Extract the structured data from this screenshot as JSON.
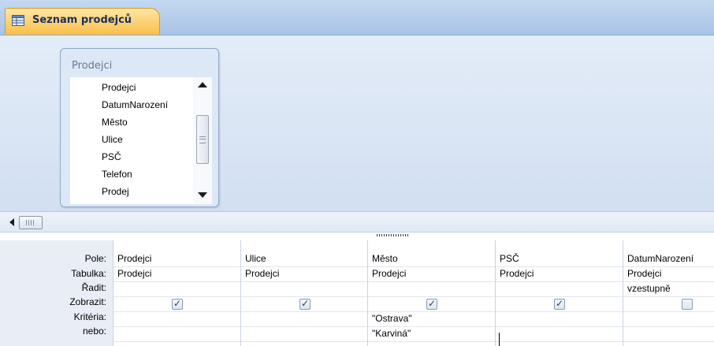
{
  "document_tab": {
    "title": "Seznam prodejců",
    "icon": "query-icon"
  },
  "table": {
    "name": "Prodejci",
    "fields": [
      "Prodejci",
      "DatumNarození",
      "Město",
      "Ulice",
      "PSČ",
      "Telefon",
      "Prodej"
    ]
  },
  "grid": {
    "row_labels": [
      "Pole:",
      "Tabulka:",
      "Řadit:",
      "Zobrazit:",
      "Kritéria:",
      "nebo:"
    ],
    "columns": [
      {
        "field": "Prodejci",
        "table": "Prodejci",
        "sort": "",
        "show": true,
        "criteria": "",
        "or": ""
      },
      {
        "field": "Ulice",
        "table": "Prodejci",
        "sort": "",
        "show": true,
        "criteria": "",
        "or": ""
      },
      {
        "field": "Město",
        "table": "Prodejci",
        "sort": "",
        "show": true,
        "criteria": "\"Ostrava\"",
        "or": "\"Karviná\""
      },
      {
        "field": "PSČ",
        "table": "Prodejci",
        "sort": "",
        "show": true,
        "criteria": "",
        "or": ""
      },
      {
        "field": "DatumNarození",
        "table": "Prodejci",
        "sort": "vzestupně",
        "show": false,
        "criteria": "",
        "or": ""
      }
    ]
  }
}
